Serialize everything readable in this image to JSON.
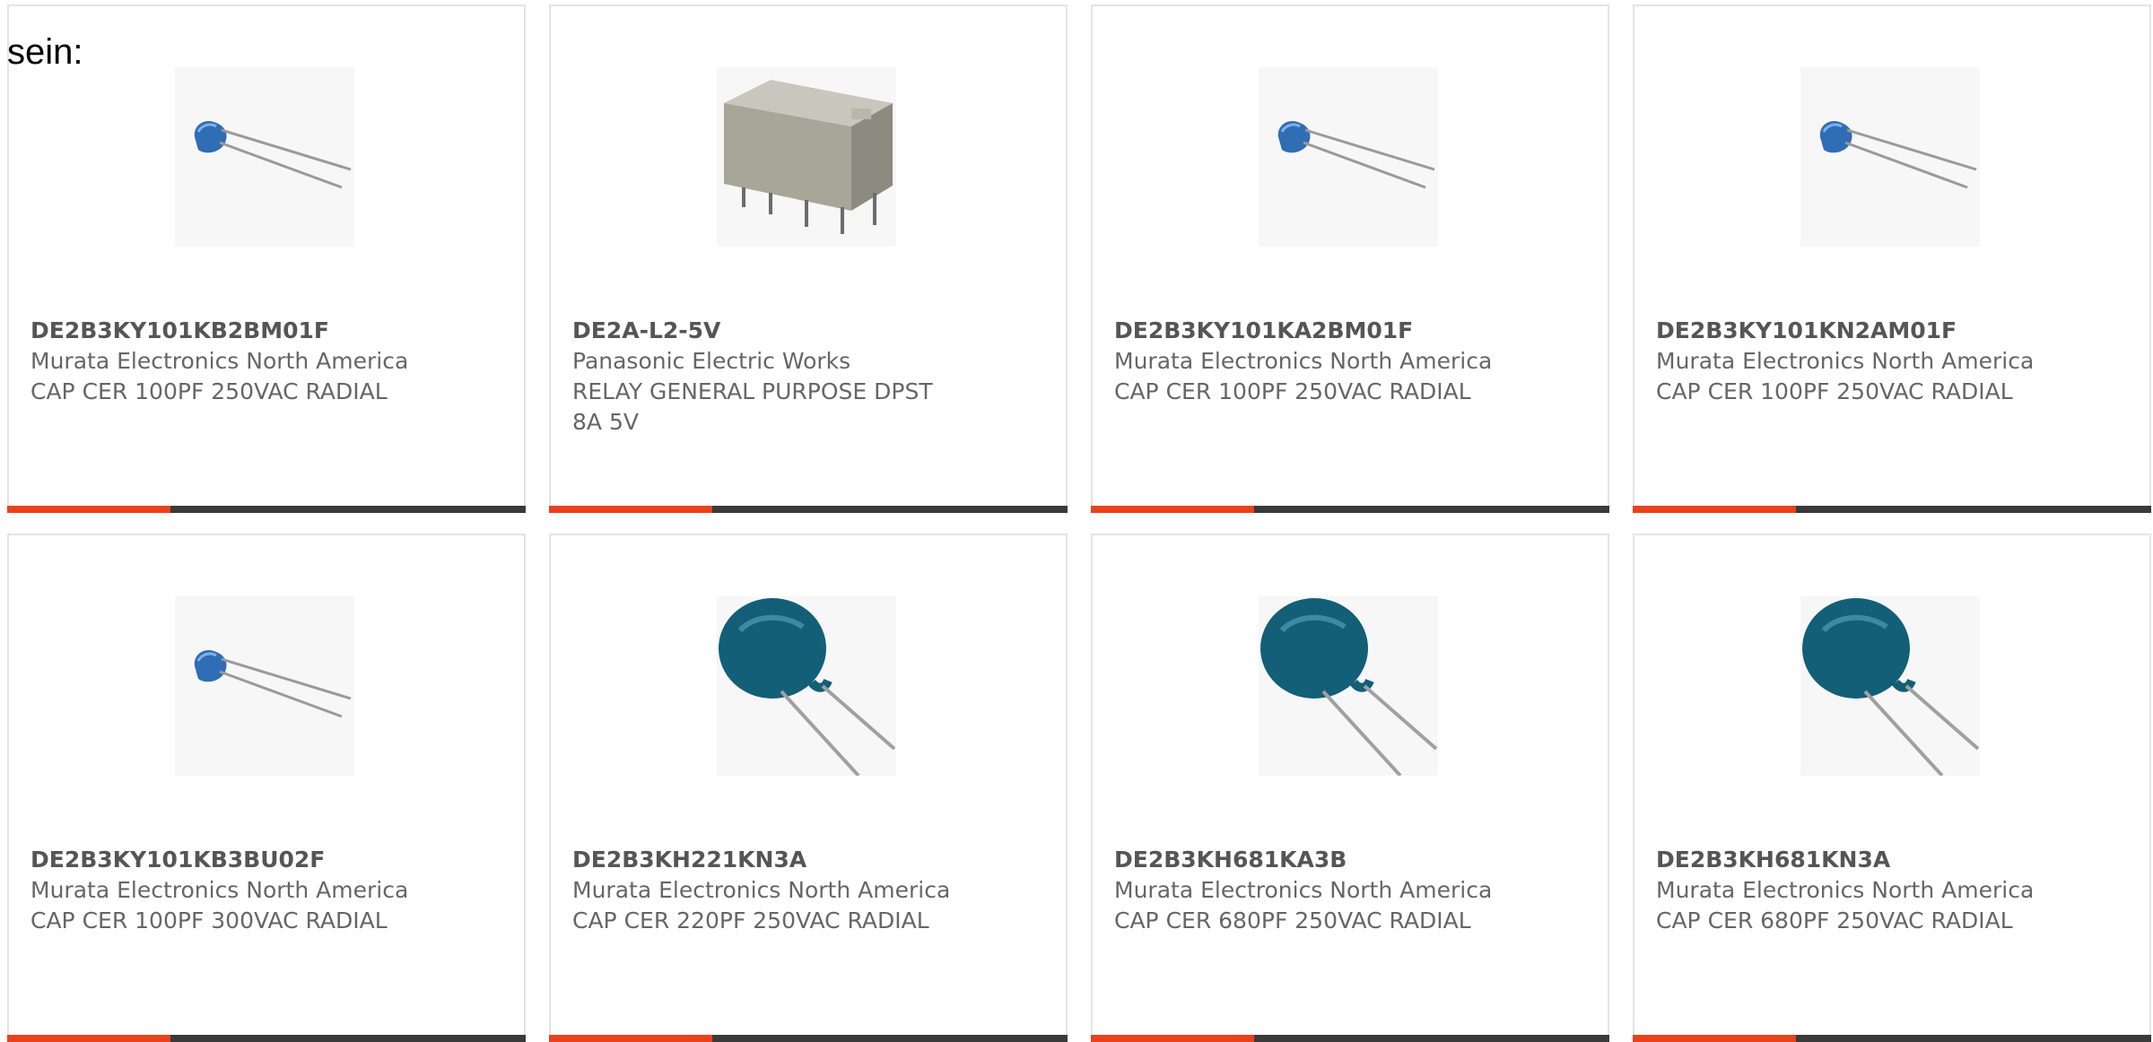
{
  "intro_text": "sein:",
  "accent_color": "#e8421c",
  "products": [
    {
      "part_number": "DE2B3KY101KB2BM01F",
      "manufacturer": "Murata Electronics North America",
      "description": "CAP CER 100PF 250VAC RADIAL",
      "image": "blue-disc-capacitor-image"
    },
    {
      "part_number": "DE2A-L2-5V",
      "manufacturer": "Panasonic Electric Works",
      "description": "RELAY GENERAL PURPOSE DPST 8A 5V",
      "image": "relay-image"
    },
    {
      "part_number": "DE2B3KY101KA2BM01F",
      "manufacturer": "Murata Electronics North America",
      "description": "CAP CER 100PF 250VAC RADIAL",
      "image": "blue-disc-capacitor-image"
    },
    {
      "part_number": "DE2B3KY101KN2AM01F",
      "manufacturer": "Murata Electronics North America",
      "description": "CAP CER 100PF 250VAC RADIAL",
      "image": "blue-disc-capacitor-image"
    },
    {
      "part_number": "DE2B3KY101KB3BU02F",
      "manufacturer": "Murata Electronics North America",
      "description": "CAP CER 100PF 300VAC RADIAL",
      "image": "blue-disc-capacitor-image"
    },
    {
      "part_number": "DE2B3KH221KN3A",
      "manufacturer": "Murata Electronics North America",
      "description": "CAP CER 220PF 250VAC RADIAL",
      "image": "teal-disc-capacitor-image"
    },
    {
      "part_number": "DE2B3KH681KA3B",
      "manufacturer": "Murata Electronics North America",
      "description": "CAP CER 680PF 250VAC RADIAL",
      "image": "teal-disc-capacitor-image"
    },
    {
      "part_number": "DE2B3KH681KN3A",
      "manufacturer": "Murata Electronics North America",
      "description": "CAP CER 680PF 250VAC RADIAL",
      "image": "teal-disc-capacitor-image"
    }
  ]
}
